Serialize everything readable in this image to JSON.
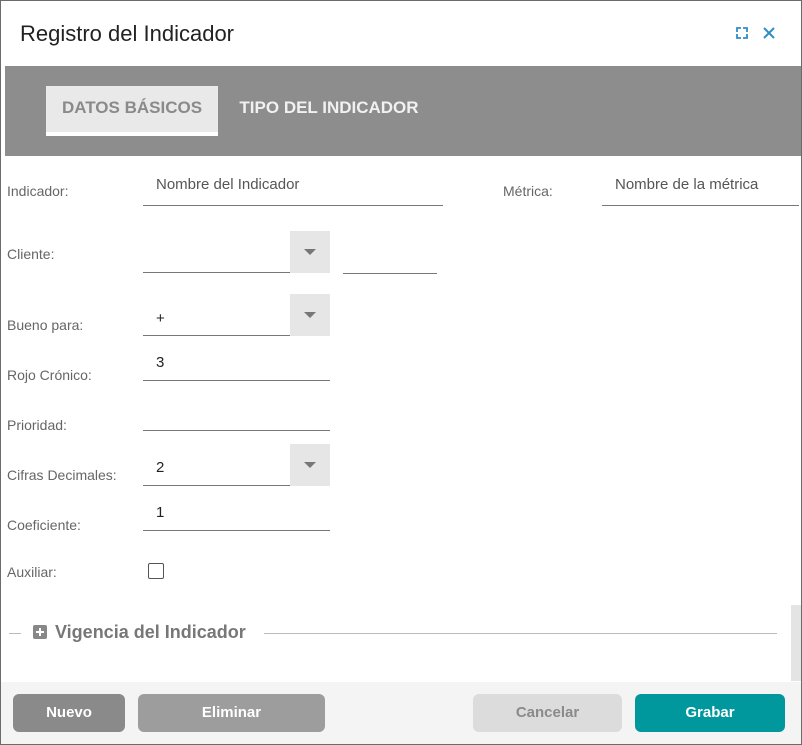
{
  "header": {
    "title": "Registro del Indicador",
    "expand_icon": "expand-icon",
    "close_icon": "close-icon"
  },
  "tabs": [
    {
      "label": "DATOS BÁSICOS",
      "active": true
    },
    {
      "label": "TIPO DEL INDICADOR",
      "active": false
    }
  ],
  "form": {
    "indicador": {
      "label": "Indicador:",
      "placeholder": "Nombre del Indicador"
    },
    "metrica": {
      "label": "Métrica:",
      "placeholder": "Nombre de la métrica"
    },
    "cliente": {
      "label": "Cliente:",
      "value": ""
    },
    "bueno_para": {
      "label": "Bueno para:",
      "value": "+"
    },
    "rojo_cronico": {
      "label": "Rojo Crónico:",
      "value": "3"
    },
    "prioridad": {
      "label": "Prioridad:",
      "value": ""
    },
    "cifras_decimales": {
      "label": "Cifras Decimales:",
      "value": "2"
    },
    "coeficiente": {
      "label": "Coeficiente:",
      "value": "1"
    },
    "auxiliar": {
      "label": "Auxiliar:",
      "checked": false
    }
  },
  "sections": [
    {
      "title": "Vigencia del Indicador"
    }
  ],
  "footer": {
    "nuevo": "Nuevo",
    "eliminar": "Eliminar",
    "cancelar": "Cancelar",
    "grabar": "Grabar"
  },
  "colors": {
    "accent": "#00979d",
    "tabbar": "#8d8d8d",
    "icon_blue": "#2e8ec7"
  }
}
